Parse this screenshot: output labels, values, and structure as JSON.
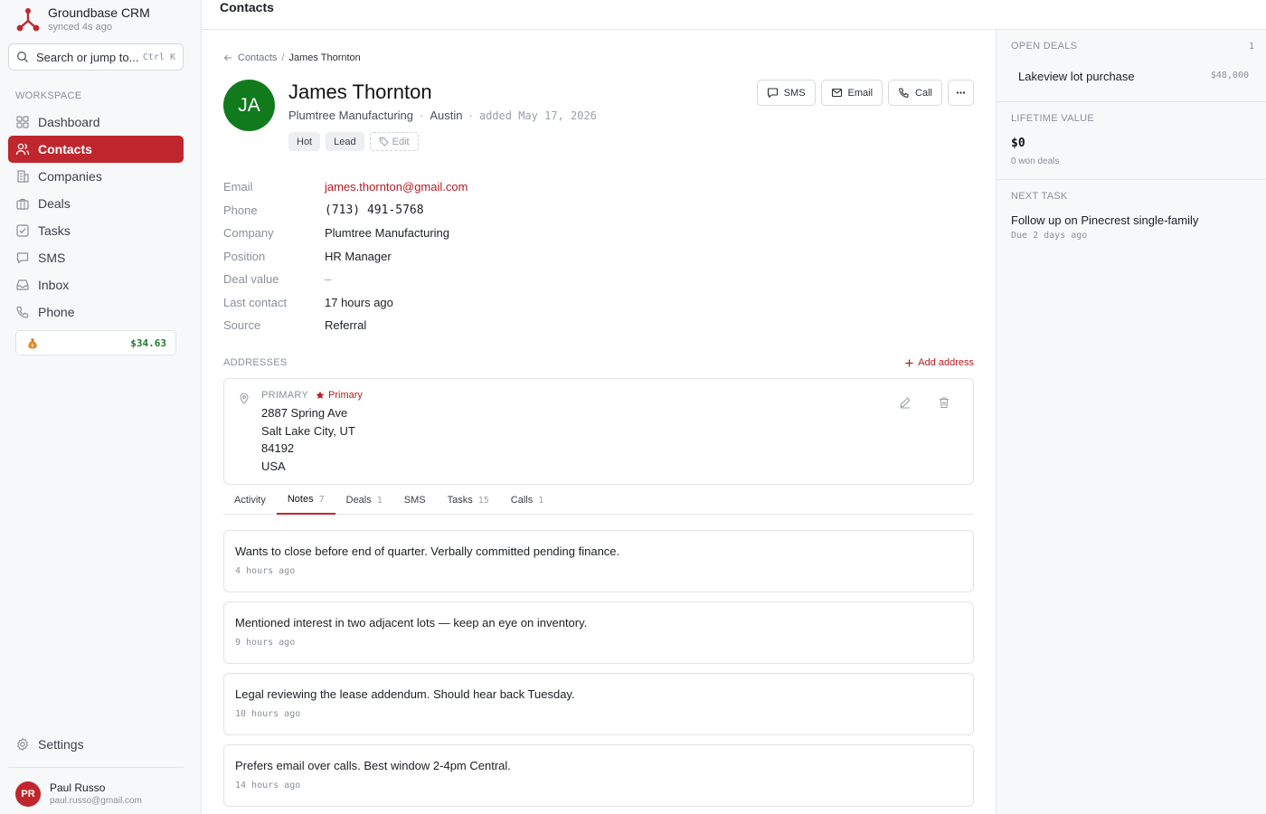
{
  "brand": {
    "name": "Groundbase CRM",
    "sync": "synced 4s ago",
    "color": "#c0262d"
  },
  "search": {
    "placeholder": "Search or jump to...",
    "shortcut": "Ctrl K"
  },
  "sidebar": {
    "section_label": "WORKSPACE",
    "items": [
      {
        "label": "Dashboard",
        "icon": "grid-icon",
        "active": false
      },
      {
        "label": "Contacts",
        "icon": "users-icon",
        "active": true
      },
      {
        "label": "Companies",
        "icon": "building-icon",
        "active": false
      },
      {
        "label": "Deals",
        "icon": "briefcase-icon",
        "active": false
      },
      {
        "label": "Tasks",
        "icon": "checkbox-icon",
        "active": false
      },
      {
        "label": "SMS",
        "icon": "message-icon",
        "active": false
      },
      {
        "label": "Inbox",
        "icon": "inbox-icon",
        "active": false
      },
      {
        "label": "Phone",
        "icon": "phone-icon",
        "active": false
      }
    ],
    "credit": {
      "icon": "money-bag-icon",
      "value": "$34.63"
    },
    "settings_label": "Settings",
    "user": {
      "initials": "PR",
      "name": "Paul Russo",
      "email": "paul.russo@gmail.com"
    }
  },
  "topbar": {
    "title": "Contacts"
  },
  "breadcrumb": {
    "parent": "Contacts",
    "sep": "/",
    "current": "James Thornton"
  },
  "contact": {
    "initials": "JA",
    "name": "James Thornton",
    "company": "Plumtree Manufacturing",
    "city": "Austin",
    "added": "added May 17, 2026",
    "tags": [
      "Hot",
      "Lead"
    ],
    "edit_tag_label": "Edit"
  },
  "actions": {
    "sms": "SMS",
    "email": "Email",
    "call": "Call"
  },
  "fields": [
    {
      "label": "Email",
      "value": "james.thornton@gmail.com"
    },
    {
      "label": "Phone",
      "value": "(713) 491-5768"
    },
    {
      "label": "Company",
      "value": "Plumtree Manufacturing"
    },
    {
      "label": "Position",
      "value": "HR Manager"
    },
    {
      "label": "Deal value",
      "value": "–"
    },
    {
      "label": "Last contact",
      "value": "17 hours ago"
    },
    {
      "label": "Source",
      "value": "Referral"
    }
  ],
  "addresses": {
    "label": "ADDRESSES",
    "add_label": "Add address",
    "items": [
      {
        "type": "PRIMARY",
        "badge": "Primary",
        "line1": "2887 Spring Ave",
        "line2": "Salt Lake City, UT",
        "line3": "84192",
        "line4": "USA"
      }
    ]
  },
  "tabs": [
    {
      "label": "Activity",
      "count": ""
    },
    {
      "label": "Notes",
      "count": "7"
    },
    {
      "label": "Deals",
      "count": "1"
    },
    {
      "label": "SMS",
      "count": ""
    },
    {
      "label": "Tasks",
      "count": "15"
    },
    {
      "label": "Calls",
      "count": "1"
    }
  ],
  "active_tab": "Notes",
  "notes": [
    {
      "text": "Wants to close before end of quarter. Verbally committed pending finance.",
      "time": "4 hours ago"
    },
    {
      "text": "Mentioned interest in two adjacent lots — keep an eye on inventory.",
      "time": "9 hours ago"
    },
    {
      "text": "Legal reviewing the lease addendum. Should hear back Tuesday.",
      "time": "10 hours ago"
    },
    {
      "text": "Prefers email over calls. Best window 2-4pm Central.",
      "time": "14 hours ago"
    }
  ],
  "right_panel": {
    "open_deals": {
      "label": "OPEN DEALS",
      "count": "1",
      "items": [
        {
          "name": "Lakeview lot purchase",
          "amount": "$48,000"
        }
      ]
    },
    "lifetime_value": {
      "label": "LIFETIME VALUE",
      "value": "$0",
      "sub": "0 won deals"
    },
    "next_task": {
      "label": "NEXT TASK",
      "title": "Follow up on Pinecrest single-family",
      "due": "Due 2 days ago"
    }
  }
}
